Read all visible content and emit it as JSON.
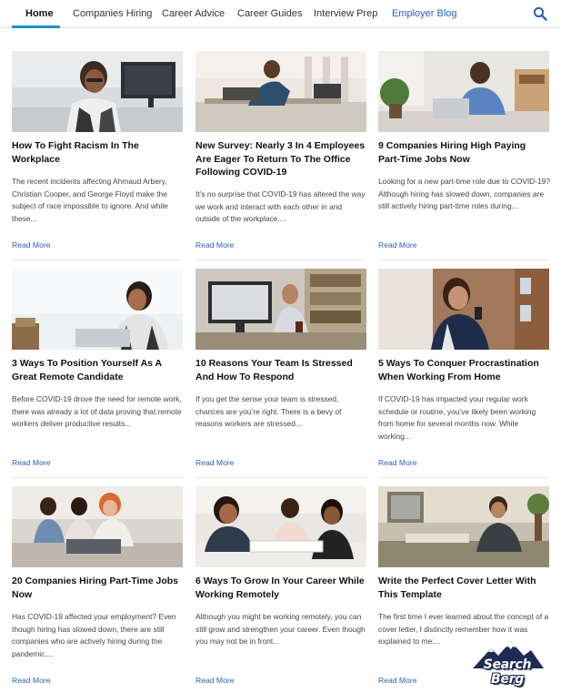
{
  "nav": {
    "items": [
      {
        "label": "Home"
      },
      {
        "label": "Companies Hiring"
      },
      {
        "label": "Career Advice"
      },
      {
        "label": "Career Guides"
      },
      {
        "label": "Interview Prep"
      },
      {
        "label": "Employer Blog"
      }
    ],
    "active": "Home",
    "search_icon": "search-icon",
    "accent_color": "#1f8fd6",
    "link_color": "#2a62b3"
  },
  "articles": [
    {
      "title": "How To Fight Racism In The Workplace",
      "excerpt": "The recent incidents affecting Ahmaud Arbery, Christian Cooper, and George Floyd make the subject of race impossible to ignore. And while these...",
      "read_more": "Read More"
    },
    {
      "title": "New Survey: Nearly 3 In 4 Employees Are Eager To Return To The Office Following COVID-19",
      "excerpt": "It’s no surprise that COVID-19 has altered the way we work and interact with each other in and outside of the workplace....",
      "read_more": "Read More"
    },
    {
      "title": "9 Companies Hiring High Paying Part-Time Jobs Now",
      "excerpt": "Looking for a new part-time role due to COVID-19? Although hiring has slowed down, companies are still actively hiring part-time roles during...",
      "read_more": "Read More"
    },
    {
      "title": "3 Ways To Position Yourself As A Great Remote Candidate",
      "excerpt": "Before COVID-19 drove the need for remote work, there was already a lot of data proving that remote workers deliver productive results...",
      "read_more": "Read More"
    },
    {
      "title": "10 Reasons Your Team Is Stressed And How To Respond",
      "excerpt": "If you get the sense your team is stressed, chances are you’re right. There is a bevy of reasons workers are stressed...",
      "read_more": "Read More"
    },
    {
      "title": "5 Ways To Conquer Procrastination When Working From Home",
      "excerpt": "If COVID-19 has impacted your regular work schedule or routine, you’ve likely been working from home for several months now. While working...",
      "read_more": "Read More"
    },
    {
      "title": "20 Companies Hiring Part-Time Jobs Now",
      "excerpt": "Has COVID-19 affected your employment? Even though hiring has slowed down, there are still companies who are actively hiring during the pandemic....",
      "read_more": "Read More"
    },
    {
      "title": "6 Ways To Grow In Your Career While Working Remotely",
      "excerpt": "Although you might be working remotely, you can still grow and strengthen your career. Even though you may not be in front...",
      "read_more": "Read More"
    },
    {
      "title": "Write the Perfect Cover Letter With This Template",
      "excerpt": "The first time I ever learned about the concept of a cover letter, I distinctly remember how it was explained to me:...",
      "read_more": "Read More"
    }
  ],
  "brand": {
    "name": "Search Berg"
  }
}
